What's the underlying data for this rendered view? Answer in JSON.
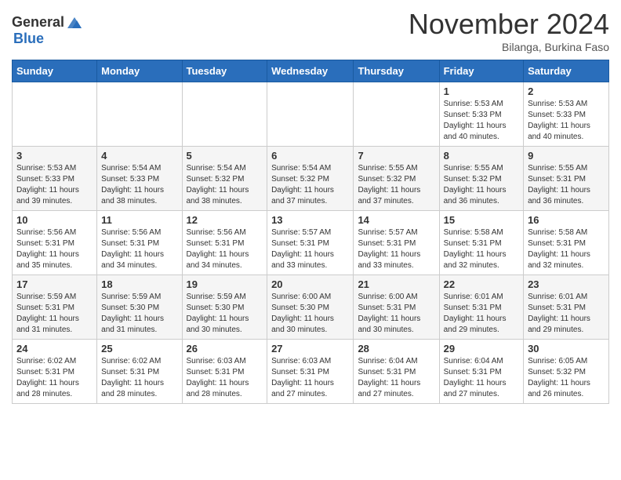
{
  "header": {
    "logo_line1": "General",
    "logo_line2": "Blue",
    "month_title": "November 2024",
    "subtitle": "Bilanga, Burkina Faso"
  },
  "days_of_week": [
    "Sunday",
    "Monday",
    "Tuesday",
    "Wednesday",
    "Thursday",
    "Friday",
    "Saturday"
  ],
  "weeks": [
    [
      {
        "day": "",
        "info": ""
      },
      {
        "day": "",
        "info": ""
      },
      {
        "day": "",
        "info": ""
      },
      {
        "day": "",
        "info": ""
      },
      {
        "day": "",
        "info": ""
      },
      {
        "day": "1",
        "info": "Sunrise: 5:53 AM\nSunset: 5:33 PM\nDaylight: 11 hours\nand 40 minutes."
      },
      {
        "day": "2",
        "info": "Sunrise: 5:53 AM\nSunset: 5:33 PM\nDaylight: 11 hours\nand 40 minutes."
      }
    ],
    [
      {
        "day": "3",
        "info": "Sunrise: 5:53 AM\nSunset: 5:33 PM\nDaylight: 11 hours\nand 39 minutes."
      },
      {
        "day": "4",
        "info": "Sunrise: 5:54 AM\nSunset: 5:33 PM\nDaylight: 11 hours\nand 38 minutes."
      },
      {
        "day": "5",
        "info": "Sunrise: 5:54 AM\nSunset: 5:32 PM\nDaylight: 11 hours\nand 38 minutes."
      },
      {
        "day": "6",
        "info": "Sunrise: 5:54 AM\nSunset: 5:32 PM\nDaylight: 11 hours\nand 37 minutes."
      },
      {
        "day": "7",
        "info": "Sunrise: 5:55 AM\nSunset: 5:32 PM\nDaylight: 11 hours\nand 37 minutes."
      },
      {
        "day": "8",
        "info": "Sunrise: 5:55 AM\nSunset: 5:32 PM\nDaylight: 11 hours\nand 36 minutes."
      },
      {
        "day": "9",
        "info": "Sunrise: 5:55 AM\nSunset: 5:31 PM\nDaylight: 11 hours\nand 36 minutes."
      }
    ],
    [
      {
        "day": "10",
        "info": "Sunrise: 5:56 AM\nSunset: 5:31 PM\nDaylight: 11 hours\nand 35 minutes."
      },
      {
        "day": "11",
        "info": "Sunrise: 5:56 AM\nSunset: 5:31 PM\nDaylight: 11 hours\nand 34 minutes."
      },
      {
        "day": "12",
        "info": "Sunrise: 5:56 AM\nSunset: 5:31 PM\nDaylight: 11 hours\nand 34 minutes."
      },
      {
        "day": "13",
        "info": "Sunrise: 5:57 AM\nSunset: 5:31 PM\nDaylight: 11 hours\nand 33 minutes."
      },
      {
        "day": "14",
        "info": "Sunrise: 5:57 AM\nSunset: 5:31 PM\nDaylight: 11 hours\nand 33 minutes."
      },
      {
        "day": "15",
        "info": "Sunrise: 5:58 AM\nSunset: 5:31 PM\nDaylight: 11 hours\nand 32 minutes."
      },
      {
        "day": "16",
        "info": "Sunrise: 5:58 AM\nSunset: 5:31 PM\nDaylight: 11 hours\nand 32 minutes."
      }
    ],
    [
      {
        "day": "17",
        "info": "Sunrise: 5:59 AM\nSunset: 5:31 PM\nDaylight: 11 hours\nand 31 minutes."
      },
      {
        "day": "18",
        "info": "Sunrise: 5:59 AM\nSunset: 5:30 PM\nDaylight: 11 hours\nand 31 minutes."
      },
      {
        "day": "19",
        "info": "Sunrise: 5:59 AM\nSunset: 5:30 PM\nDaylight: 11 hours\nand 30 minutes."
      },
      {
        "day": "20",
        "info": "Sunrise: 6:00 AM\nSunset: 5:30 PM\nDaylight: 11 hours\nand 30 minutes."
      },
      {
        "day": "21",
        "info": "Sunrise: 6:00 AM\nSunset: 5:31 PM\nDaylight: 11 hours\nand 30 minutes."
      },
      {
        "day": "22",
        "info": "Sunrise: 6:01 AM\nSunset: 5:31 PM\nDaylight: 11 hours\nand 29 minutes."
      },
      {
        "day": "23",
        "info": "Sunrise: 6:01 AM\nSunset: 5:31 PM\nDaylight: 11 hours\nand 29 minutes."
      }
    ],
    [
      {
        "day": "24",
        "info": "Sunrise: 6:02 AM\nSunset: 5:31 PM\nDaylight: 11 hours\nand 28 minutes."
      },
      {
        "day": "25",
        "info": "Sunrise: 6:02 AM\nSunset: 5:31 PM\nDaylight: 11 hours\nand 28 minutes."
      },
      {
        "day": "26",
        "info": "Sunrise: 6:03 AM\nSunset: 5:31 PM\nDaylight: 11 hours\nand 28 minutes."
      },
      {
        "day": "27",
        "info": "Sunrise: 6:03 AM\nSunset: 5:31 PM\nDaylight: 11 hours\nand 27 minutes."
      },
      {
        "day": "28",
        "info": "Sunrise: 6:04 AM\nSunset: 5:31 PM\nDaylight: 11 hours\nand 27 minutes."
      },
      {
        "day": "29",
        "info": "Sunrise: 6:04 AM\nSunset: 5:31 PM\nDaylight: 11 hours\nand 27 minutes."
      },
      {
        "day": "30",
        "info": "Sunrise: 6:05 AM\nSunset: 5:32 PM\nDaylight: 11 hours\nand 26 minutes."
      }
    ]
  ]
}
